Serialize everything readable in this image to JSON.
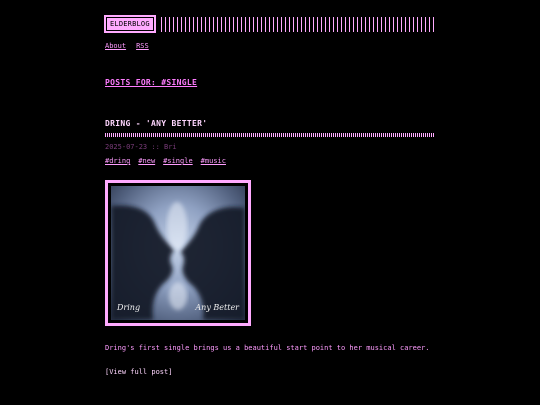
{
  "header": {
    "logo": "ELDERBLOG"
  },
  "nav": {
    "items": [
      "About",
      "RSS"
    ]
  },
  "page": {
    "heading": "POSTS FOR: #SINGLE"
  },
  "post": {
    "title": "DRING - 'ANY BETTER'",
    "meta": "2025-07-23 :: Bri",
    "tags": [
      "#dring",
      "#new",
      "#single",
      "#music"
    ],
    "cover": {
      "artist": "Dring",
      "album": "Any Better"
    },
    "summary": "Dring's first single brings us a beautiful start point to her musical career.",
    "more_link": "[View full post]"
  },
  "colors": {
    "background": "#000000",
    "accent": "#ffaaff",
    "link": "#ff9cff",
    "meta": "#7a3c7a"
  }
}
